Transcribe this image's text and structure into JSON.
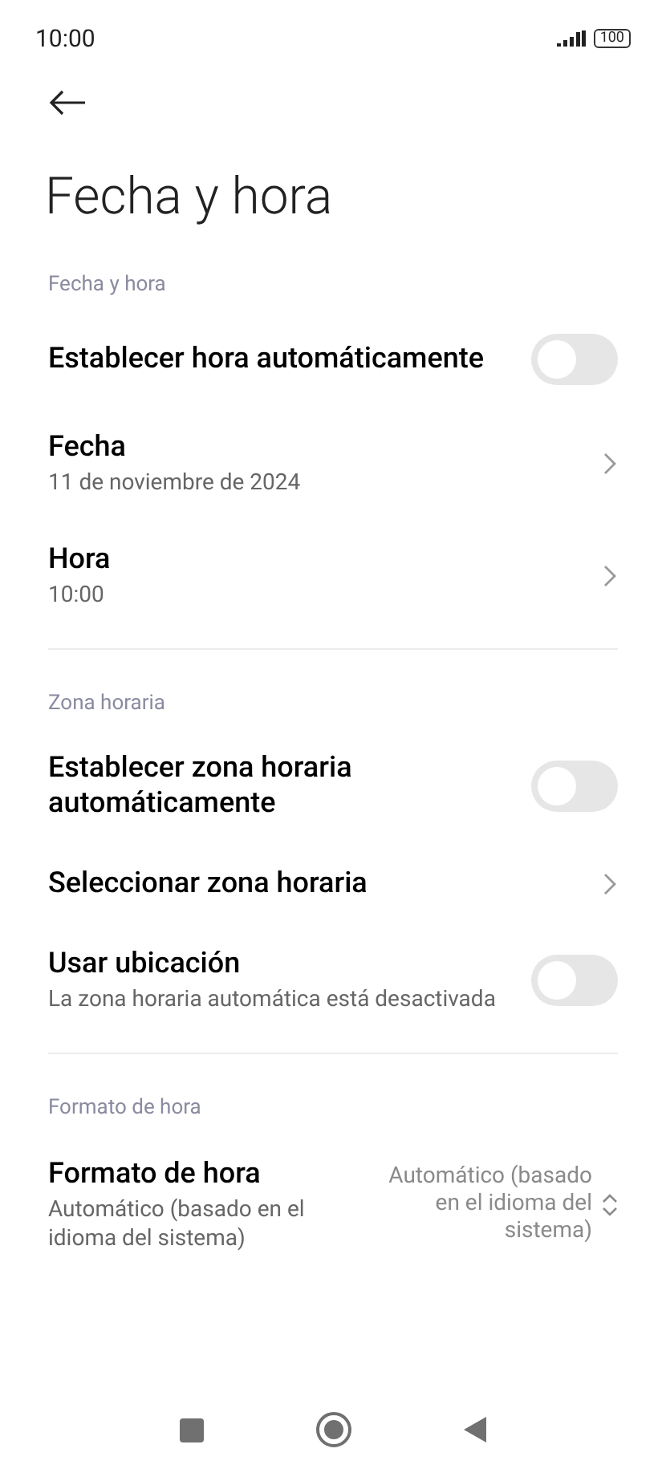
{
  "status_bar": {
    "time": "10:00",
    "battery": "100"
  },
  "title": "Fecha y hora",
  "sections": [
    {
      "header": "Fecha y hora",
      "items": [
        {
          "kind": "toggle",
          "title": "Establecer hora automáticamente",
          "on": false
        },
        {
          "kind": "link",
          "title": "Fecha",
          "subtitle": "11 de noviembre de 2024"
        },
        {
          "kind": "link",
          "title": "Hora",
          "subtitle": "10:00"
        }
      ]
    },
    {
      "header": "Zona horaria",
      "items": [
        {
          "kind": "toggle",
          "title": "Establecer zona horaria automáticamente",
          "on": false
        },
        {
          "kind": "link",
          "title": "Seleccionar zona horaria"
        },
        {
          "kind": "toggle",
          "title": "Usar ubicación",
          "subtitle": "La zona horaria automática está desactivada",
          "on": false
        }
      ]
    },
    {
      "header": "Formato de hora",
      "items": [
        {
          "kind": "dropdown",
          "title": "Formato de hora",
          "subtitle": "Automático (basado en el idioma del sistema)",
          "value": "Automático (basado en el idioma del sistema)"
        }
      ]
    }
  ]
}
